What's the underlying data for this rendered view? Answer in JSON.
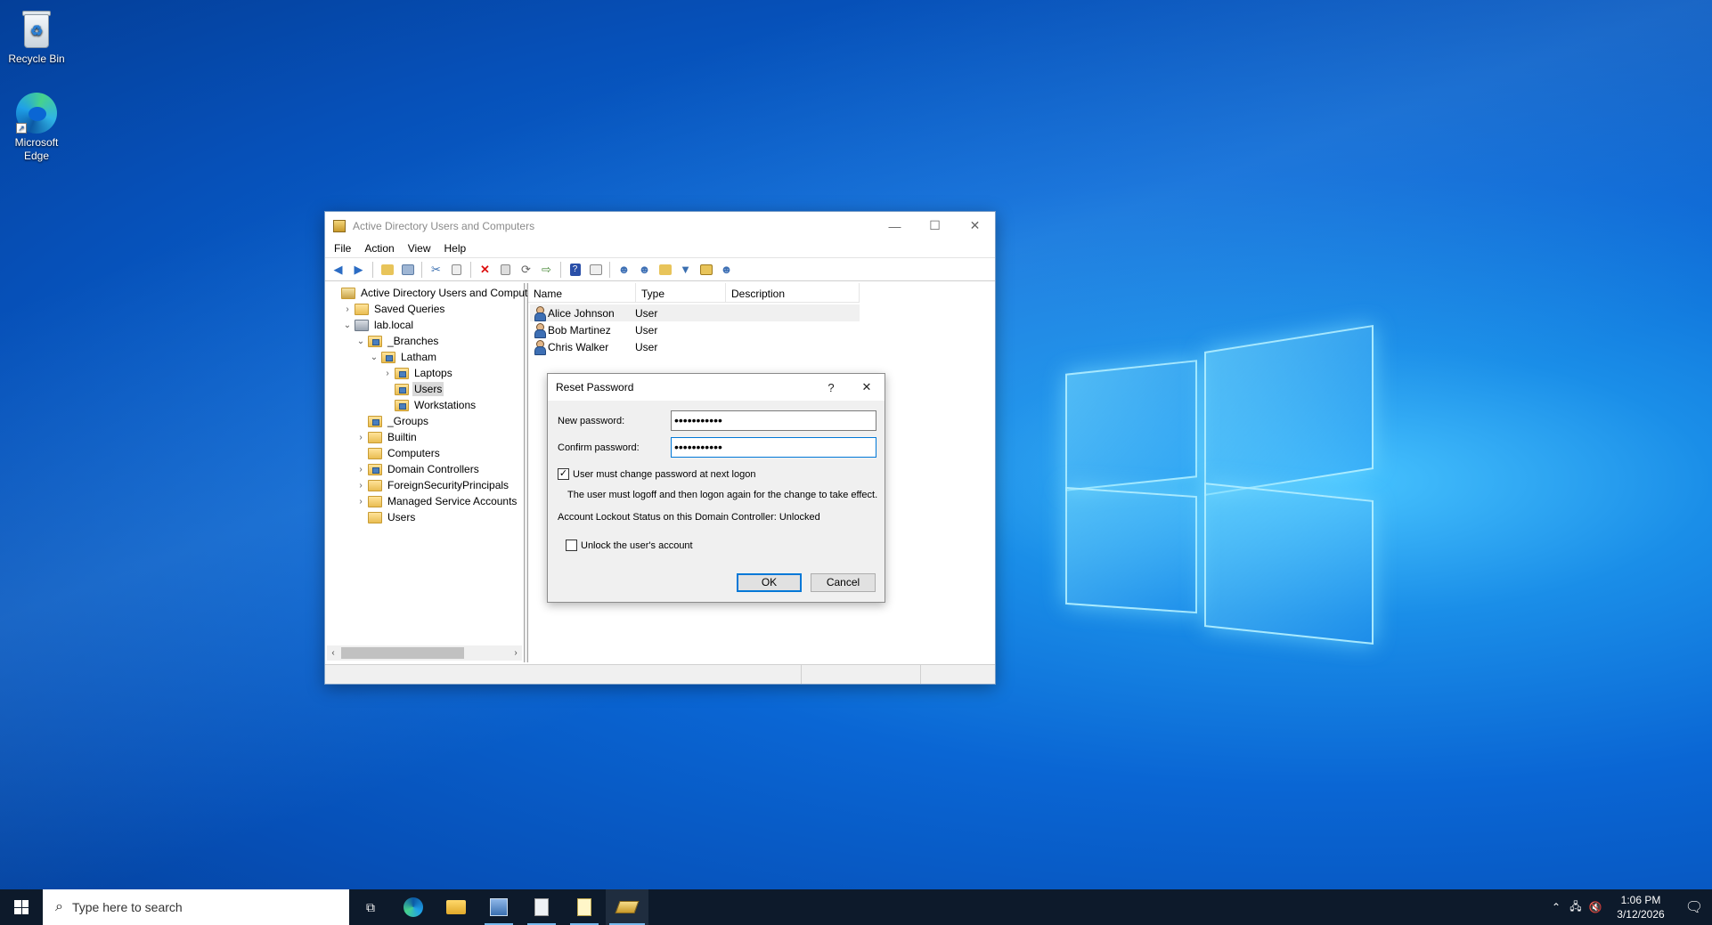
{
  "desktop": {
    "icons": [
      {
        "label": "Recycle Bin",
        "icon": "recycle-bin-icon"
      },
      {
        "label": "Microsoft Edge",
        "icon": "edge-icon"
      }
    ]
  },
  "window": {
    "title": "Active Directory Users and Computers",
    "menu": [
      "File",
      "Action",
      "View",
      "Help"
    ],
    "tree": [
      {
        "label": "Active Directory Users and Computers",
        "level": 0,
        "expander": "",
        "kind": "root"
      },
      {
        "label": "Saved Queries",
        "level": 1,
        "expander": ">",
        "kind": "folder"
      },
      {
        "label": "lab.local",
        "level": 1,
        "expander": "v",
        "kind": "domain"
      },
      {
        "label": "_Branches",
        "level": 2,
        "expander": "v",
        "kind": "ou"
      },
      {
        "label": "Latham",
        "level": 3,
        "expander": "v",
        "kind": "ou"
      },
      {
        "label": "Laptops",
        "level": 4,
        "expander": ">",
        "kind": "ou"
      },
      {
        "label": "Users",
        "level": 4,
        "expander": "",
        "kind": "ou",
        "selected": true
      },
      {
        "label": "Workstations",
        "level": 4,
        "expander": "",
        "kind": "ou"
      },
      {
        "label": "_Groups",
        "level": 2,
        "expander": "",
        "kind": "ou"
      },
      {
        "label": "Builtin",
        "level": 2,
        "expander": ">",
        "kind": "folder"
      },
      {
        "label": "Computers",
        "level": 2,
        "expander": "",
        "kind": "folder"
      },
      {
        "label": "Domain Controllers",
        "level": 2,
        "expander": ">",
        "kind": "ou"
      },
      {
        "label": "ForeignSecurityPrincipals",
        "level": 2,
        "expander": ">",
        "kind": "folder"
      },
      {
        "label": "Managed Service Accounts",
        "level": 2,
        "expander": ">",
        "kind": "folder"
      },
      {
        "label": "Users",
        "level": 2,
        "expander": "",
        "kind": "folder"
      }
    ],
    "list": {
      "columns": [
        "Name",
        "Type",
        "Description"
      ],
      "rows": [
        {
          "name": "Alice Johnson",
          "type": "User",
          "description": ""
        },
        {
          "name": "Bob Martinez",
          "type": "User",
          "description": ""
        },
        {
          "name": "Chris Walker",
          "type": "User",
          "description": ""
        }
      ]
    }
  },
  "dialog": {
    "title": "Reset Password",
    "help": "?",
    "close": "✕",
    "new_password_label": "New password:",
    "new_password_value": "•••••••••••",
    "confirm_password_label": "Confirm password:",
    "confirm_password_value": "•••••••••••",
    "must_change_label": "User must change password at next logon",
    "must_change_checked": true,
    "logoff_note": "The user must logoff and then logon again for the change to take effect.",
    "lockout_status": "Account Lockout Status on this Domain Controller: Unlocked",
    "unlock_label": "Unlock the user's account",
    "unlock_checked": false,
    "ok": "OK",
    "cancel": "Cancel"
  },
  "taskbar": {
    "search_placeholder": "Type here to search",
    "time": "1:06 PM",
    "date": "3/12/2026"
  }
}
